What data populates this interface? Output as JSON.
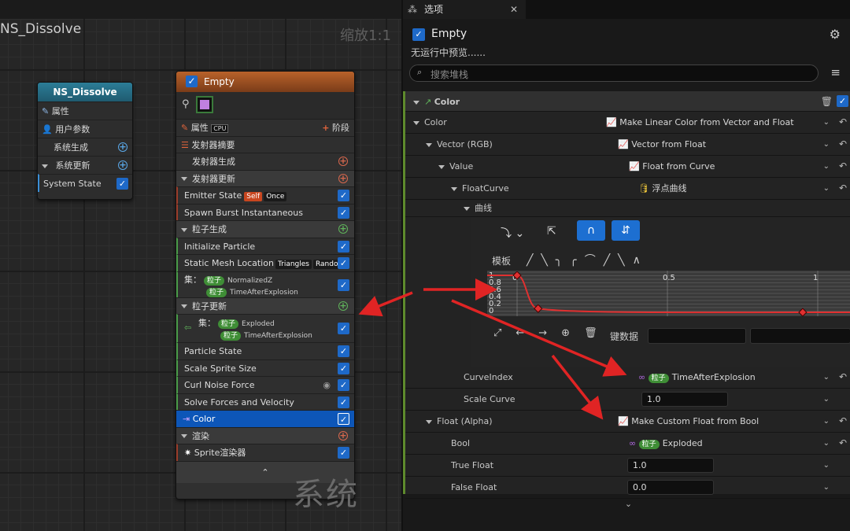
{
  "graph": {
    "title": "NS_Dissolve",
    "zoom": "缩放1:1",
    "watermark": "系统"
  },
  "system_node": {
    "title": "NS_Dissolve",
    "rows": [
      "属性",
      "用户参数",
      "系统生成",
      "系统更新",
      "System State"
    ]
  },
  "emitter": {
    "title": "Empty",
    "props": "属性",
    "cpu": "CPU",
    "stage": "阶段",
    "rows": [
      {
        "t": "发射器摘要"
      },
      {
        "t": "发射器生成"
      },
      {
        "t": "发射器更新"
      },
      {
        "t": "Emitter State",
        "tag1": "Self",
        "tag2": "Once"
      },
      {
        "t": "Spawn Burst Instantaneous"
      },
      {
        "t": "粒子生成"
      },
      {
        "t": "Initialize Particle"
      },
      {
        "t": "Static Mesh Location",
        "tag1": "Triangles",
        "tag2": "Random"
      },
      {
        "t": "集：",
        "p1": "粒子",
        "v1": "NormalizedZ",
        "p2": "粒子",
        "v2": "TimeAfterExplosion"
      },
      {
        "t": "粒子更新"
      },
      {
        "t": "集：",
        "p1": "粒子",
        "v1": "Exploded",
        "p2": "粒子",
        "v2": "TimeAfterExplosion"
      },
      {
        "t": "Particle State"
      },
      {
        "t": "Scale Sprite Size"
      },
      {
        "t": "Curl Noise Force"
      },
      {
        "t": "Solve Forces and Velocity"
      },
      {
        "t": "Color"
      },
      {
        "t": "渲染"
      },
      {
        "t": "Sprite渲染器"
      }
    ]
  },
  "panel": {
    "tab": "选项",
    "obj": "Empty",
    "preview": "无运行中预览......",
    "search_ph": "搜索堆栈",
    "section": "Color",
    "rows": {
      "color": {
        "l": "Color",
        "v": "Make Linear Color from Vector and Float"
      },
      "vector": {
        "l": "Vector (RGB)",
        "v": "Vector from Float"
      },
      "value": {
        "l": "Value",
        "v": "Float from Curve"
      },
      "fcurve": {
        "l": "FloatCurve",
        "v": "浮点曲线"
      },
      "curve": {
        "l": "曲线"
      },
      "template": "模板",
      "keydata": "键数据",
      "cidx": {
        "l": "CurveIndex",
        "p": "粒子",
        "v": "TimeAfterExplosion"
      },
      "scale": {
        "l": "Scale Curve",
        "v": "1.0"
      },
      "alpha": {
        "l": "Float (Alpha)",
        "v": "Make Custom Float from Bool"
      },
      "bool": {
        "l": "Bool",
        "p": "粒子",
        "v": "Exploded"
      },
      "tf": {
        "l": "True Float",
        "v": "1.0"
      },
      "ff": {
        "l": "False Float",
        "v": "0.0"
      }
    },
    "curve_axis": {
      "y": [
        "1",
        "0.8",
        "0.6",
        "0.4",
        "0.2",
        "0"
      ],
      "x": [
        "0",
        "0.5",
        "1"
      ]
    },
    "curve_keys": [
      {
        "t": 0,
        "v": 1.0
      },
      {
        "t": 0.07,
        "v": 0.12
      },
      {
        "t": 0.95,
        "v": 0.02
      }
    ]
  },
  "colors": {
    "accent": "#1d6fd1",
    "emitter_header": "#b9622a",
    "system_header": "#2c7d97",
    "curve": "#e03030",
    "arrow": "#e02424"
  }
}
